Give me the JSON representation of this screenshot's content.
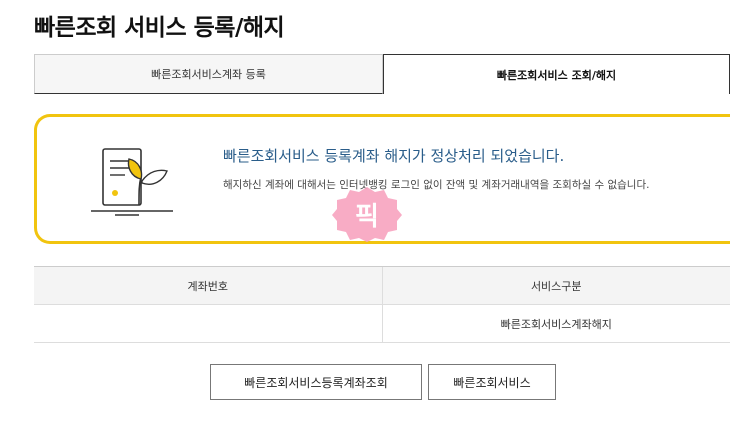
{
  "page": {
    "title": "빠른조회 서비스 등록/해지"
  },
  "tabs": [
    {
      "label": "빠른조회서비스계좌 등록",
      "active": false
    },
    {
      "label": "빠른조회서비스 조회/해지",
      "active": true
    }
  ],
  "notice": {
    "headline": "빠른조회서비스 등록계좌 해지가 정상처리 되었습니다.",
    "body": "해지하신 계좌에 대해서는 인터넷뱅킹 로그인 없이 잔액 및 계좌거래내역을 조회하실 수 없습니다.",
    "icon": "document-sprout-icon",
    "accent": "#f1c40f"
  },
  "stamp": {
    "text": "픽",
    "color": "#f7a3bf"
  },
  "table": {
    "headers": [
      "계좌번호",
      "서비스구분"
    ],
    "rows": [
      [
        "",
        "빠른조회서비스계좌해지"
      ]
    ]
  },
  "buttons": {
    "list_label": "빠른조회서비스등록계좌조회",
    "service_label": "빠른조회서비스"
  }
}
